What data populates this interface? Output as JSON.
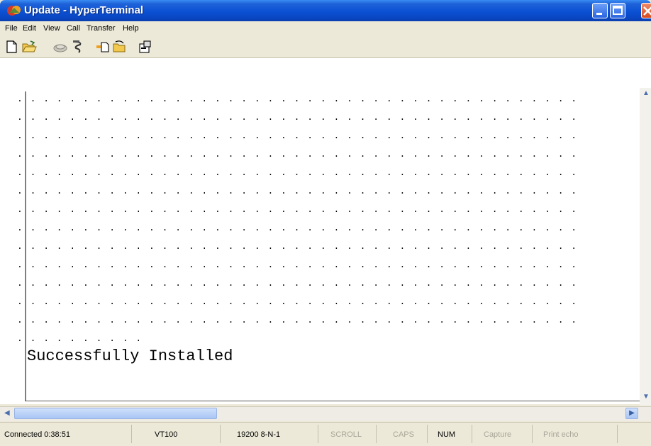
{
  "window": {
    "title": "Update - HyperTerminal",
    "title_bar_color": "#0b50d3"
  },
  "menu": {
    "items": [
      "File",
      "Edit",
      "View",
      "Call",
      "Transfer",
      "Help"
    ]
  },
  "toolbar": {
    "icons": [
      "new-icon",
      "open-icon",
      "disconnect-icon",
      "connect-icon",
      "send-icon",
      "receive-icon",
      "properties-icon"
    ]
  },
  "terminal": {
    "dot_line": ". . . . . . . . . . . . . . . . . . . . . . . . . . . . . . . . . . . . . . . . . . .",
    "short_dot_line": ". . . . . . . . . .",
    "message": "Successfully Installed"
  },
  "status": {
    "connected": "Connected 0:38:51",
    "emulation": "VT100",
    "settings": "19200 8-N-1",
    "scroll": "SCROLL",
    "caps": "CAPS",
    "num": "NUM",
    "capture": "Capture",
    "print_echo": "Print echo"
  }
}
